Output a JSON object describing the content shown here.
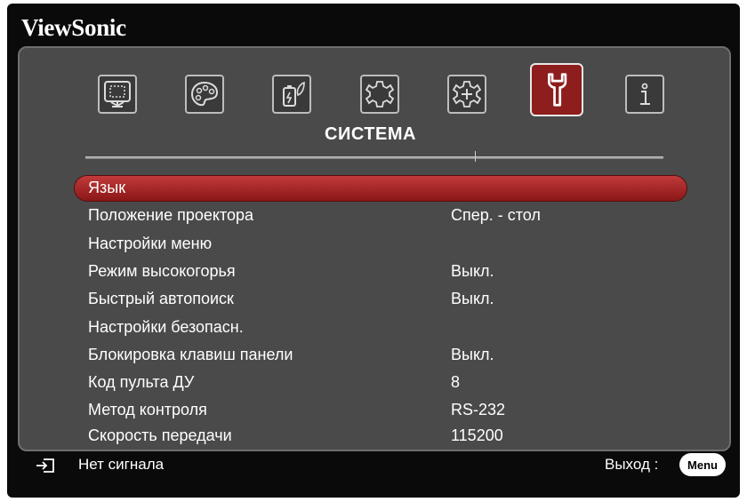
{
  "osd": {
    "brand": "ViewSonic",
    "section_title": "СИСТЕМА",
    "tabs": [
      {
        "icon": "display-icon",
        "active": false
      },
      {
        "icon": "picture-palette-icon",
        "active": false
      },
      {
        "icon": "power-saving-icon",
        "active": false
      },
      {
        "icon": "basic-settings-gear-icon",
        "active": false
      },
      {
        "icon": "advanced-settings-gear-icon",
        "active": false
      },
      {
        "icon": "system-wrench-icon",
        "active": true
      },
      {
        "icon": "information-icon",
        "active": false
      }
    ],
    "items": [
      {
        "label": "Язык",
        "value": ""
      },
      {
        "label": "Положение проектора",
        "value": "Спер. - стол"
      },
      {
        "label": "Настройки меню",
        "value": ""
      },
      {
        "label": "Режим высокогорья",
        "value": "Выкл."
      },
      {
        "label": "Быстрый автопоиск",
        "value": "Выкл."
      },
      {
        "label": "Настройки безопасн.",
        "value": ""
      },
      {
        "label": "Блокировка клавиш панели",
        "value": "Выкл."
      },
      {
        "label": "Код пульта ДУ",
        "value": "8"
      },
      {
        "label": "Метод контроля",
        "value": "RS-232"
      },
      {
        "label": "Скорость передачи",
        "value": "115200"
      }
    ],
    "selected_index": 0,
    "footer": {
      "input_icon": "source-input-icon",
      "status": "Нет сигнала",
      "exit_label": "Выход :",
      "menu_button": "Menu"
    },
    "colors": {
      "accent": "#a52525",
      "panel": "#4a4a4a",
      "frame": "#0a0a0a",
      "text": "#ffffff"
    }
  }
}
